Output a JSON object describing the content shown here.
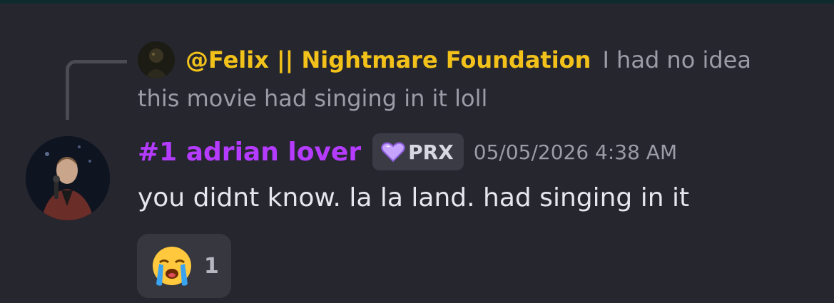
{
  "reply": {
    "author": "@Felix || Nightmare Foundation",
    "text_line1": "I had no idea",
    "text_line2": "this movie had singing in it loll"
  },
  "message": {
    "author": "#1 adrian lover",
    "tag": {
      "icon": "purple-heart-icon",
      "label": "PRX"
    },
    "timestamp": "05/05/2026 4:38 AM",
    "content": "you didnt know. la la land. had singing in it"
  },
  "reactions": [
    {
      "emoji": "loudly-crying-face-icon",
      "count": "1"
    }
  ],
  "colors": {
    "background": "#26262f",
    "reply_author": "#f2c21b",
    "author": "#b53bff",
    "muted_text": "#9b9ca6",
    "message_text": "#e6e7ee"
  }
}
